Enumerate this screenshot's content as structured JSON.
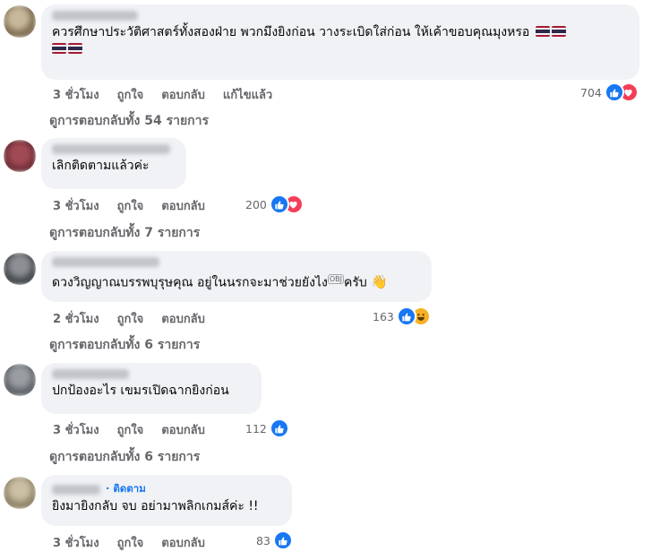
{
  "comments": [
    {
      "text": "ควรศึกษาประวัติศาสตร์ทั้งสองฝ่าย พวกมึงยิงก่อน วางระเบิดใส่ก่อน ให้เค้าขอบคุณมุงหรอ",
      "time": "3 ชั่วโมง",
      "like_label": "ถูกใจ",
      "reply_label": "ตอบกลับ",
      "edited_label": "แก้ไขแล้ว",
      "reaction_count": "704",
      "reactions": [
        "like-icon",
        "love-icon"
      ],
      "view_replies": "ดูการตอบกลับทั้ง 54 รายการ"
    },
    {
      "text": "เลิกติดตามแล้วค่ะ",
      "time": "3 ชั่วโมง",
      "like_label": "ถูกใจ",
      "reply_label": "ตอบกลับ",
      "reaction_count": "200",
      "reactions": [
        "like-icon",
        "love-icon"
      ],
      "view_replies": "ดูการตอบกลับทั้ง 7 รายการ"
    },
    {
      "text": "ดวงวิญญาณบรรพบุรุษคุณ อยู่ในนรกจะมาช่วยยังไง",
      "text_end": "ครับ",
      "overlay_mark": "OBJ",
      "time": "2 ชั่วโมง",
      "like_label": "ถูกใจ",
      "reply_label": "ตอบกลับ",
      "reaction_count": "163",
      "reactions": [
        "like-icon",
        "haha-icon"
      ],
      "view_replies": "ดูการตอบกลับทั้ง 6 รายการ"
    },
    {
      "text": "ปกป้องอะไร เขมรเปิดฉากยิงก่อน",
      "time": "3 ชั่วโมง",
      "like_label": "ถูกใจ",
      "reply_label": "ตอบกลับ",
      "reaction_count": "112",
      "reactions": [
        "like-icon"
      ],
      "view_replies": "ดูการตอบกลับทั้ง 6 รายการ"
    },
    {
      "follow_label": "· ติดตาม",
      "text": "ยิงมายิงกลับ จบ อย่ามาพลิกเกมส์ค่ะ !!",
      "time": "3 ชั่วโมง",
      "like_label": "ถูกใจ",
      "reply_label": "ตอบกลับ",
      "reaction_count": "83",
      "reactions": [
        "like-icon"
      ]
    }
  ],
  "colors": {
    "bubble": "#f0f2f5",
    "meta_text": "#65676b",
    "like_blue": "#1877f2",
    "love_red": "#f33e58",
    "haha_yellow": "#f7b125"
  }
}
